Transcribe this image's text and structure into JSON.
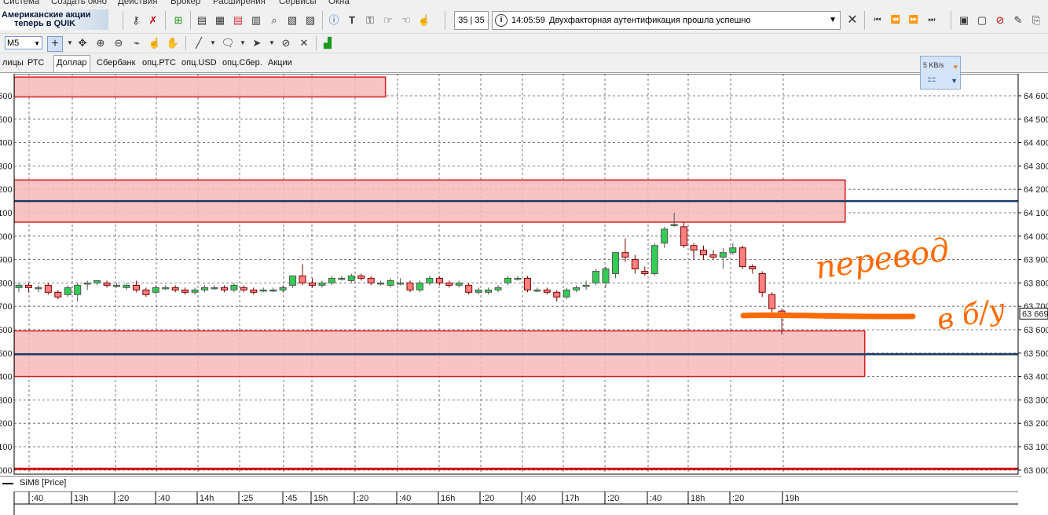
{
  "menu": [
    "Система",
    "Создать окно",
    "Действия",
    "Брокер",
    "Расширения",
    "Сервисы",
    "Окна"
  ],
  "banner": {
    "line1": "Американские акции",
    "line2": "теперь в QUIK"
  },
  "message_counter": "35 | 35",
  "message": {
    "time": "14:05:59",
    "text": "Двухфакторная аутентификация прошла успешно"
  },
  "timeframe": "M5",
  "tabs": [
    {
      "label": "лицы",
      "active": false
    },
    {
      "label": "РТС",
      "active": false
    },
    {
      "label": "Доллар",
      "active": true
    },
    {
      "label": "Сбербанк",
      "active": false
    },
    {
      "label": "опц.РТС",
      "active": false
    },
    {
      "label": "опц.USD",
      "active": false
    },
    {
      "label": "опц.Сбер.",
      "active": false
    },
    {
      "label": "Акции",
      "active": false
    }
  ],
  "network": {
    "speed": "5 KB/s"
  },
  "legend": "SiM8 [Price]",
  "annotation": {
    "text1": "перевод",
    "text2": "в б/у"
  },
  "colors": {
    "up": "#33cc55",
    "down": "#ff7f7f",
    "zone_fill": "#f8b8b8",
    "zone_border": "#d02020",
    "level": "#1a3a6a",
    "annotation": "#ff6a00"
  },
  "chart_data": {
    "type": "candlestick",
    "instrument": "SiM8",
    "y_ticks": [
      "64 600",
      "64 500",
      "64 400",
      "64 300",
      "64 200",
      "64 100",
      "64 000",
      "63 900",
      "63 800",
      "63 700",
      "63 600",
      "63 500",
      "63 400",
      "63 300",
      "63 200",
      "63 100",
      "63 000"
    ],
    "ylim": [
      63000,
      64700
    ],
    "current_price": "63 669",
    "x_labels": [
      ":40",
      "13h",
      ":20",
      ":40",
      "14h",
      ":25",
      ":45",
      "15h",
      ":20",
      ":40",
      "16h",
      ":20",
      ":40",
      "17h",
      ":20",
      ":40",
      "18h",
      ":20",
      "19h"
    ],
    "zones": [
      {
        "from": 64595,
        "to": 64680,
        "start_candle": 0,
        "end_candle": 37
      },
      {
        "from": 64060,
        "to": 64240,
        "start_candle": 0,
        "end_candle": 84
      },
      {
        "from": 63400,
        "to": 63595,
        "start_candle": 0,
        "end_candle": 86
      }
    ],
    "levels": [
      64150,
      63495,
      63005
    ],
    "candles": [
      {
        "o": 63780,
        "h": 63800,
        "l": 63760,
        "c": 63790
      },
      {
        "o": 63790,
        "h": 63800,
        "l": 63760,
        "c": 63780
      },
      {
        "o": 63780,
        "h": 63790,
        "l": 63760,
        "c": 63780
      },
      {
        "o": 63790,
        "h": 63800,
        "l": 63750,
        "c": 63760
      },
      {
        "o": 63760,
        "h": 63770,
        "l": 63730,
        "c": 63740
      },
      {
        "o": 63750,
        "h": 63790,
        "l": 63740,
        "c": 63780
      },
      {
        "o": 63750,
        "h": 63800,
        "l": 63720,
        "c": 63790
      },
      {
        "o": 63800,
        "h": 63810,
        "l": 63770,
        "c": 63800
      },
      {
        "o": 63800,
        "h": 63810,
        "l": 63790,
        "c": 63810
      },
      {
        "o": 63800,
        "h": 63810,
        "l": 63780,
        "c": 63790
      },
      {
        "o": 63790,
        "h": 63800,
        "l": 63780,
        "c": 63790
      },
      {
        "o": 63780,
        "h": 63800,
        "l": 63770,
        "c": 63790
      },
      {
        "o": 63790,
        "h": 63810,
        "l": 63760,
        "c": 63770
      },
      {
        "o": 63770,
        "h": 63780,
        "l": 63740,
        "c": 63750
      },
      {
        "o": 63760,
        "h": 63790,
        "l": 63750,
        "c": 63780
      },
      {
        "o": 63780,
        "h": 63790,
        "l": 63770,
        "c": 63780
      },
      {
        "o": 63780,
        "h": 63790,
        "l": 63760,
        "c": 63770
      },
      {
        "o": 63770,
        "h": 63780,
        "l": 63750,
        "c": 63760
      },
      {
        "o": 63760,
        "h": 63780,
        "l": 63750,
        "c": 63770
      },
      {
        "o": 63770,
        "h": 63790,
        "l": 63760,
        "c": 63780
      },
      {
        "o": 63780,
        "h": 63790,
        "l": 63770,
        "c": 63780
      },
      {
        "o": 63780,
        "h": 63790,
        "l": 63760,
        "c": 63770
      },
      {
        "o": 63770,
        "h": 63800,
        "l": 63760,
        "c": 63790
      },
      {
        "o": 63780,
        "h": 63790,
        "l": 63760,
        "c": 63770
      },
      {
        "o": 63770,
        "h": 63780,
        "l": 63750,
        "c": 63760
      },
      {
        "o": 63770,
        "h": 63780,
        "l": 63760,
        "c": 63770
      },
      {
        "o": 63770,
        "h": 63780,
        "l": 63760,
        "c": 63770
      },
      {
        "o": 63770,
        "h": 63790,
        "l": 63760,
        "c": 63780
      },
      {
        "o": 63790,
        "h": 63830,
        "l": 63780,
        "c": 63830
      },
      {
        "o": 63830,
        "h": 63880,
        "l": 63790,
        "c": 63800
      },
      {
        "o": 63800,
        "h": 63820,
        "l": 63780,
        "c": 63790
      },
      {
        "o": 63790,
        "h": 63810,
        "l": 63780,
        "c": 63800
      },
      {
        "o": 63800,
        "h": 63830,
        "l": 63790,
        "c": 63820
      },
      {
        "o": 63820,
        "h": 63830,
        "l": 63810,
        "c": 63820
      },
      {
        "o": 63810,
        "h": 63840,
        "l": 63800,
        "c": 63830
      },
      {
        "o": 63830,
        "h": 63840,
        "l": 63810,
        "c": 63820
      },
      {
        "o": 63820,
        "h": 63830,
        "l": 63790,
        "c": 63800
      },
      {
        "o": 63800,
        "h": 63810,
        "l": 63790,
        "c": 63800
      },
      {
        "o": 63790,
        "h": 63820,
        "l": 63780,
        "c": 63810
      },
      {
        "o": 63800,
        "h": 63820,
        "l": 63790,
        "c": 63800
      },
      {
        "o": 63800,
        "h": 63810,
        "l": 63760,
        "c": 63770
      },
      {
        "o": 63770,
        "h": 63810,
        "l": 63760,
        "c": 63800
      },
      {
        "o": 63800,
        "h": 63830,
        "l": 63790,
        "c": 63820
      },
      {
        "o": 63820,
        "h": 63830,
        "l": 63790,
        "c": 63800
      },
      {
        "o": 63800,
        "h": 63810,
        "l": 63780,
        "c": 63790
      },
      {
        "o": 63790,
        "h": 63810,
        "l": 63780,
        "c": 63800
      },
      {
        "o": 63790,
        "h": 63800,
        "l": 63750,
        "c": 63760
      },
      {
        "o": 63760,
        "h": 63780,
        "l": 63750,
        "c": 63770
      },
      {
        "o": 63760,
        "h": 63780,
        "l": 63750,
        "c": 63770
      },
      {
        "o": 63770,
        "h": 63790,
        "l": 63760,
        "c": 63780
      },
      {
        "o": 63800,
        "h": 63830,
        "l": 63790,
        "c": 63820
      },
      {
        "o": 63820,
        "h": 63830,
        "l": 63810,
        "c": 63820
      },
      {
        "o": 63820,
        "h": 63830,
        "l": 63760,
        "c": 63770
      },
      {
        "o": 63770,
        "h": 63780,
        "l": 63760,
        "c": 63770
      },
      {
        "o": 63770,
        "h": 63780,
        "l": 63750,
        "c": 63760
      },
      {
        "o": 63760,
        "h": 63770,
        "l": 63720,
        "c": 63740
      },
      {
        "o": 63740,
        "h": 63780,
        "l": 63730,
        "c": 63770
      },
      {
        "o": 63770,
        "h": 63790,
        "l": 63760,
        "c": 63780
      },
      {
        "o": 63790,
        "h": 63810,
        "l": 63770,
        "c": 63790
      },
      {
        "o": 63800,
        "h": 63860,
        "l": 63790,
        "c": 63850
      },
      {
        "o": 63800,
        "h": 63870,
        "l": 63780,
        "c": 63860
      },
      {
        "o": 63840,
        "h": 63930,
        "l": 63820,
        "c": 63930
      },
      {
        "o": 63930,
        "h": 63990,
        "l": 63890,
        "c": 63910
      },
      {
        "o": 63900,
        "h": 63920,
        "l": 63840,
        "c": 63860
      },
      {
        "o": 63850,
        "h": 63870,
        "l": 63830,
        "c": 63840
      },
      {
        "o": 63840,
        "h": 63970,
        "l": 63830,
        "c": 63960
      },
      {
        "o": 63970,
        "h": 64040,
        "l": 63950,
        "c": 64030
      },
      {
        "o": 64050,
        "h": 64100,
        "l": 64040,
        "c": 64050
      },
      {
        "o": 64040,
        "h": 64060,
        "l": 63950,
        "c": 63960
      },
      {
        "o": 63960,
        "h": 63970,
        "l": 63900,
        "c": 63940
      },
      {
        "o": 63940,
        "h": 63960,
        "l": 63900,
        "c": 63920
      },
      {
        "o": 63920,
        "h": 63940,
        "l": 63900,
        "c": 63910
      },
      {
        "o": 63910,
        "h": 63950,
        "l": 63860,
        "c": 63930
      },
      {
        "o": 63930,
        "h": 63970,
        "l": 63920,
        "c": 63950
      },
      {
        "o": 63950,
        "h": 63960,
        "l": 63860,
        "c": 63870
      },
      {
        "o": 63870,
        "h": 63880,
        "l": 63840,
        "c": 63860
      },
      {
        "o": 63840,
        "h": 63850,
        "l": 63740,
        "c": 63760
      },
      {
        "o": 63750,
        "h": 63760,
        "l": 63660,
        "c": 63690
      },
      {
        "o": 63680,
        "h": 63690,
        "l": 63580,
        "c": 63670
      }
    ]
  }
}
